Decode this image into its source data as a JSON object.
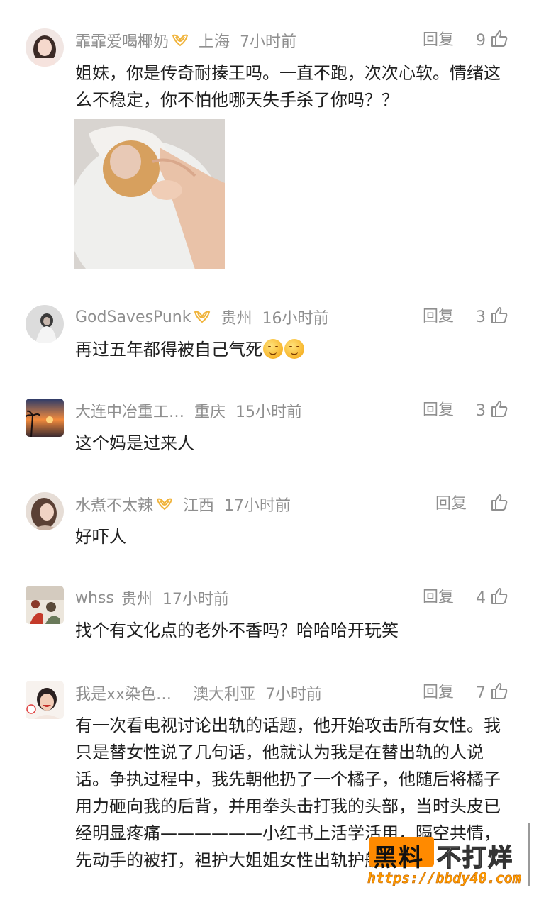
{
  "reply_label": "回复",
  "comments": [
    {
      "name": "霏霏爱喝椰奶",
      "badge": true,
      "location": "上海",
      "time": "7小时前",
      "likes": "9",
      "text": "姐妹，你是传奇耐揍王吗。一直不跑，次次心软。情绪这么不稳定，你不怕他哪天失手杀了你吗？？",
      "has_image": true
    },
    {
      "name": "GodSavesPunk",
      "badge": true,
      "location": "贵州",
      "time": "16小时前",
      "likes": "3",
      "text": "再过五年都得被自己气死"
    },
    {
      "name": "大连中冶重工…",
      "badge": false,
      "location": "重庆",
      "time": "15小时前",
      "likes": "3",
      "text": "这个妈是过来人"
    },
    {
      "name": "水煮不太辣",
      "badge": true,
      "location": "江西",
      "time": "17小时前",
      "likes": "",
      "text": "好吓人"
    },
    {
      "name": "whss",
      "badge": false,
      "location": "贵州",
      "time": "17小时前",
      "likes": "4",
      "text": "找个有文化点的老外不香吗？哈哈哈开玩笑"
    },
    {
      "name": "我是xx染色…",
      "badge": false,
      "location": "澳大利亚",
      "time": "7小时前",
      "likes": "7",
      "text": "有一次看电视讨论出轨的话题，他开始攻击所有女性。我只是替女性说了几句话，他就认为我是在替出轨的人说话。争执过程中，我先朝他扔了一个橘子，他随后将橘子用力砸向我的后背，并用拳头击打我的头部，当时头皮已经明显疼痛——————小红书上活学活用，隔空共情，先动手的被打，袒护大姐姐女性出轨护航者"
    }
  ],
  "watermark": {
    "brand_black": "黑料",
    "brand_white": "不打烊",
    "url": "https://bbdy40.com"
  },
  "colors": {
    "meta_gray": "#8f8f8f",
    "text": "#1f1f1f",
    "watermark_orange": "#ff8a00"
  }
}
